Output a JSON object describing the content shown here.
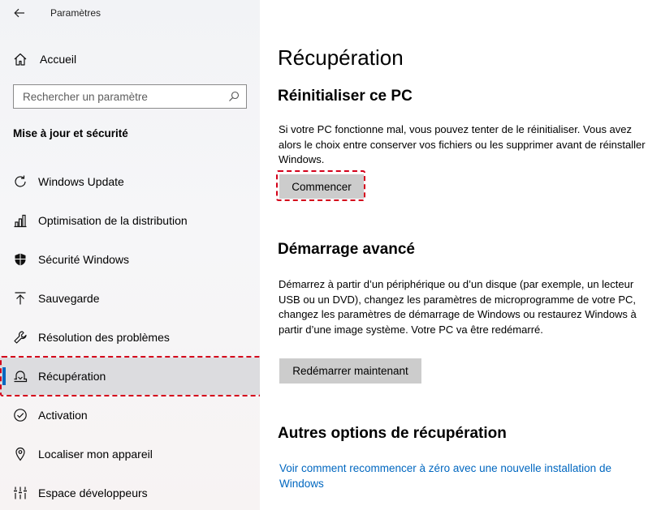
{
  "app": {
    "title": "Paramètres"
  },
  "sidebar": {
    "home_label": "Accueil",
    "search_placeholder": "Rechercher un paramètre",
    "section_title": "Mise à jour et sécurité",
    "items": [
      {
        "label": "Windows Update",
        "icon": "refresh-icon"
      },
      {
        "label": "Optimisation de la distribution",
        "icon": "delivery-optimization-icon"
      },
      {
        "label": "Sécurité Windows",
        "icon": "shield-icon"
      },
      {
        "label": "Sauvegarde",
        "icon": "backup-arrow-icon"
      },
      {
        "label": "Résolution des problèmes",
        "icon": "wrench-icon"
      },
      {
        "label": "Récupération",
        "icon": "recovery-icon",
        "selected": true
      },
      {
        "label": "Activation",
        "icon": "activation-check-icon"
      },
      {
        "label": "Localiser mon appareil",
        "icon": "find-device-icon"
      },
      {
        "label": "Espace développeurs",
        "icon": "developer-tools-icon"
      }
    ]
  },
  "main": {
    "title": "Récupération",
    "reset": {
      "heading": "Réinitialiser ce PC",
      "description": "Si votre PC fonctionne mal, vous pouvez tenter de le réinitialiser. Vous avez alors le choix entre conserver vos fichiers ou les supprimer avant de réinstaller Windows.",
      "button": "Commencer"
    },
    "advanced": {
      "heading": "Démarrage avancé",
      "description": "Démarrez à partir d’un périphérique ou d’un disque (par exemple, un lecteur USB ou un DVD), changez les paramètres de microprogramme de votre PC, changez les paramètres de démarrage de Windows ou restaurez Windows à partir d’une image système. Votre PC va être redémarré.",
      "button": "Redémarrer maintenant"
    },
    "other": {
      "heading": "Autres options de récupération",
      "link": "Voir comment recommencer à zéro avec une nouvelle installation de Windows"
    }
  },
  "colors": {
    "accent": "#0067c0",
    "highlight": "#d4001a",
    "button": "#cccccc",
    "selected_bg": "#dcdcdf"
  }
}
